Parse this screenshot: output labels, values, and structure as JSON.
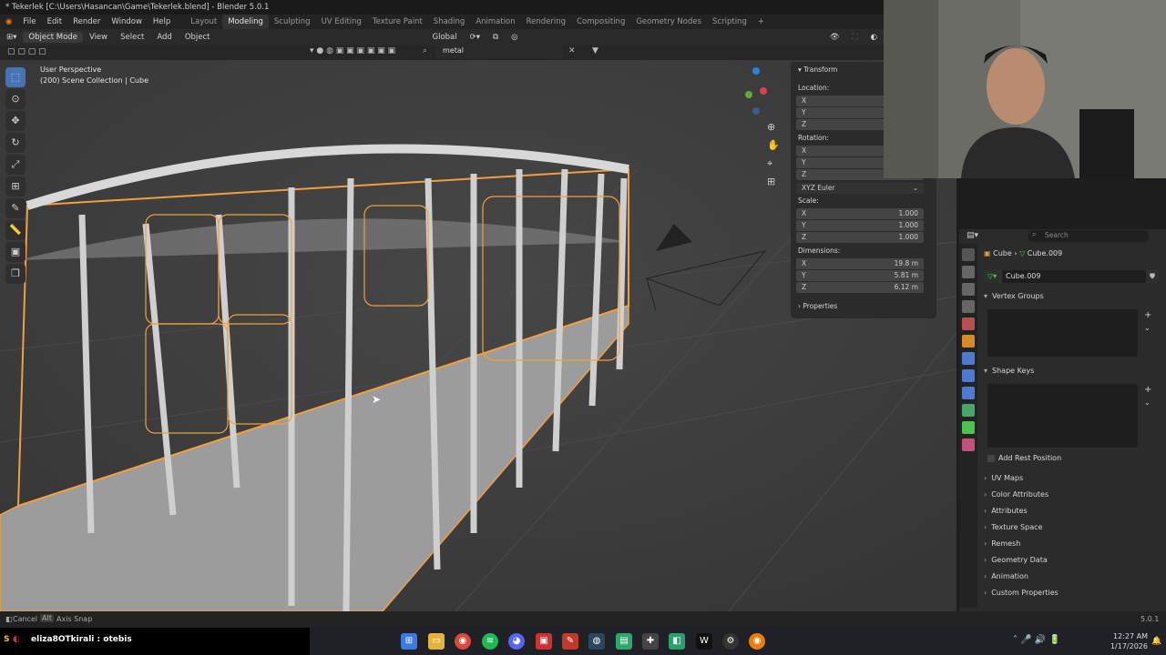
{
  "titlebar": {
    "title": "* Tekerlek [C:\\Users\\Hasancan\\Game\\Tekerlek.blend] - Blender 5.0.1"
  },
  "menu": [
    "File",
    "Edit",
    "Render",
    "Window",
    "Help"
  ],
  "workspaces": [
    "Layout",
    "Modeling",
    "Sculpting",
    "UV Editing",
    "Texture Paint",
    "Shading",
    "Animation",
    "Rendering",
    "Compositing",
    "Geometry Nodes",
    "Scripting"
  ],
  "active_workspace": "Modeling",
  "header": {
    "mode": "Object Mode",
    "view": "View",
    "select": "Select",
    "add": "Add",
    "object": "Object",
    "orientation": "Global",
    "search_value": "metal"
  },
  "viewport": {
    "perspective": "User Perspective",
    "collection": "(200) Scene Collection | Cube"
  },
  "npanel": {
    "transform": "Transform",
    "location": "Location:",
    "rotation": "Rotation:",
    "rotation_mode": "XYZ Euler",
    "scale": "Scale:",
    "scale_vals": [
      "1.000",
      "1.000",
      "1.000"
    ],
    "dimensions": "Dimensions:",
    "dim_vals": [
      "19.8 m",
      "5.81 m",
      "6.12 m"
    ],
    "properties": "Properties",
    "axes": [
      "X",
      "Y",
      "Z"
    ]
  },
  "props": {
    "search_placeholder": "Search",
    "breadcrumb_obj": "Cube",
    "breadcrumb_mesh": "Cube.009",
    "mesh_name": "Cube.009",
    "vertex_groups": "Vertex Groups",
    "shape_keys": "Shape Keys",
    "add_rest": "Add Rest Position",
    "sections": [
      "UV Maps",
      "Color Attributes",
      "Attributes",
      "Texture Space",
      "Remesh",
      "Geometry Data",
      "Animation",
      "Custom Properties"
    ]
  },
  "status": {
    "cancel": "Cancel",
    "alt": "Alt",
    "axis_snap": "Axis Snap",
    "version": "5.0.1"
  },
  "taskbar": {
    "stream": "eliza8OTkirali : otebis",
    "time": "12:27 AM",
    "date": "1/17/2026"
  },
  "colors": {
    "accent": "#4772b3",
    "selection": "#f29f3c"
  }
}
